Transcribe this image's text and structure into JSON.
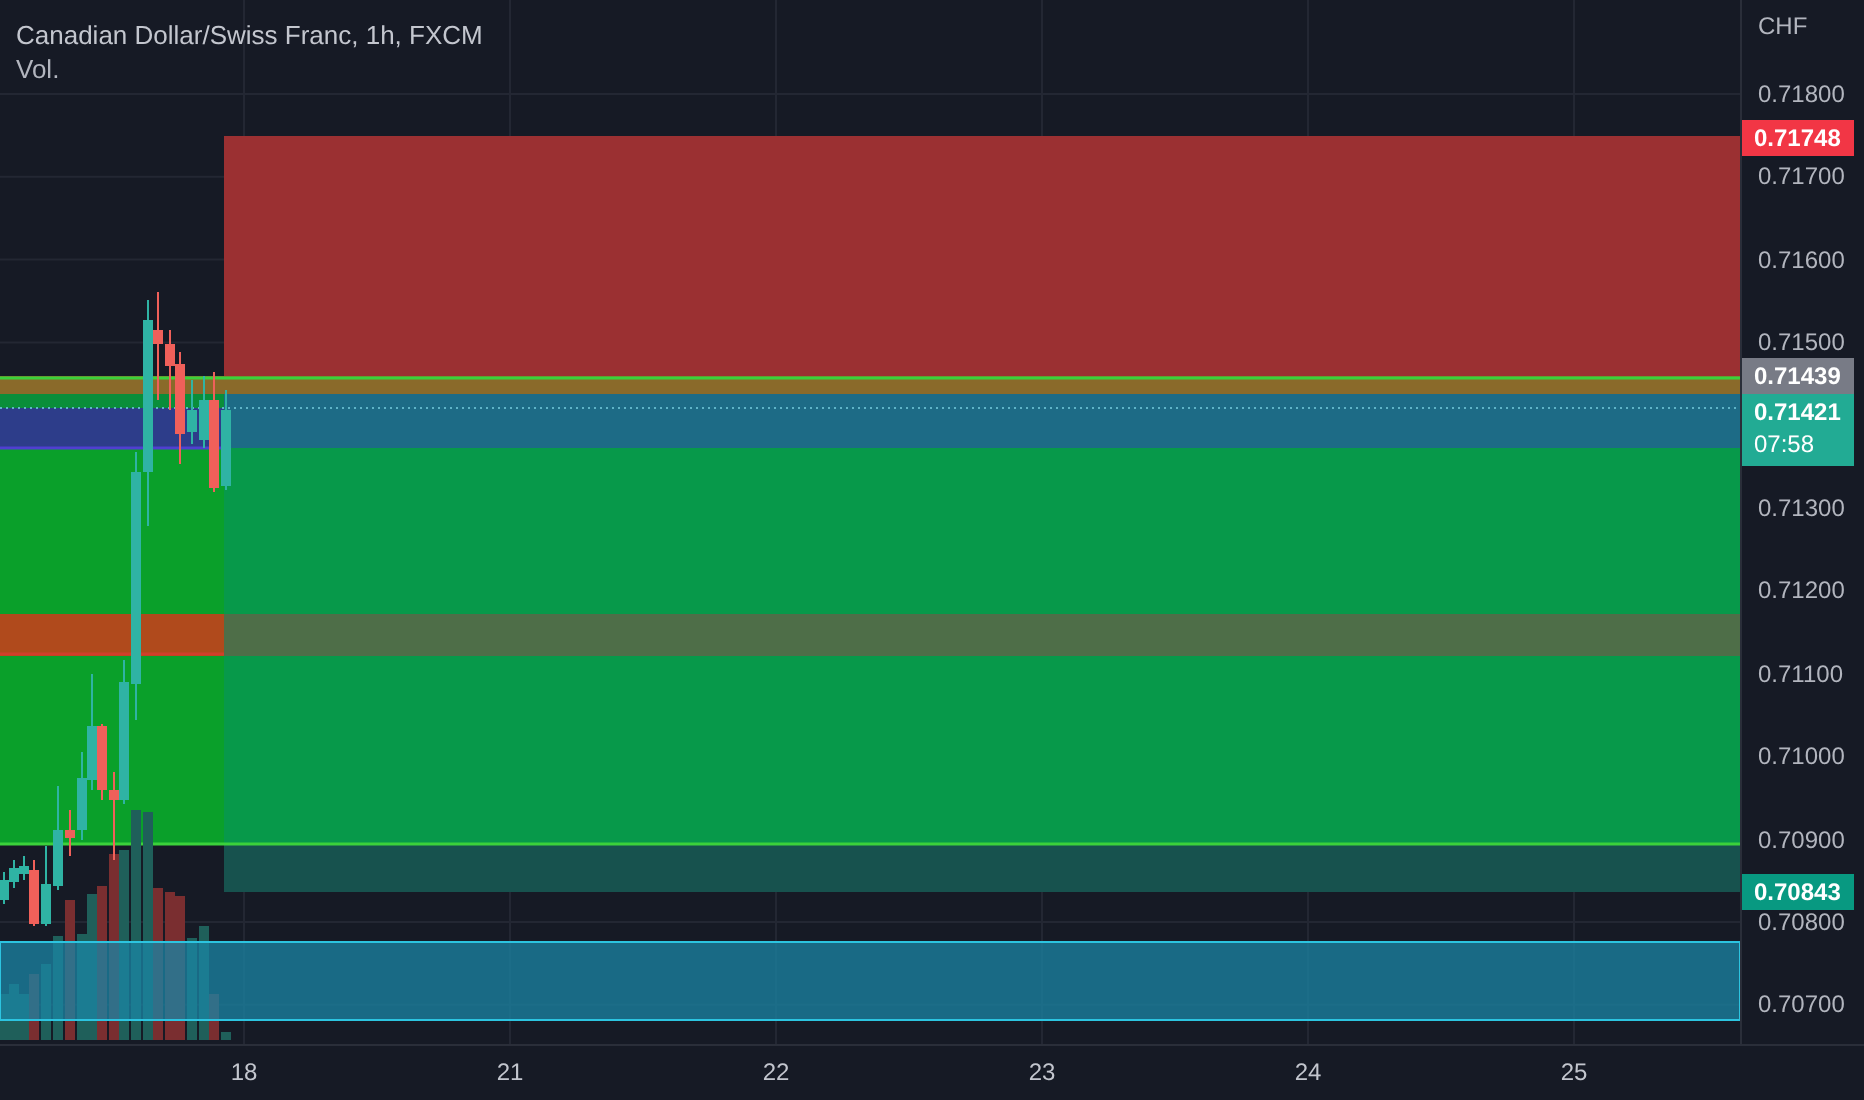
{
  "legend": {
    "title": "Canadian Dollar/Swiss Franc, 1h, FXCM",
    "volume_label": "Vol."
  },
  "price_axis": {
    "currency": "CHF",
    "ticks": [
      "0.71800",
      "0.71700",
      "0.71600",
      "0.71500",
      "0.71300",
      "0.71200",
      "0.71100",
      "0.71000",
      "0.70900",
      "0.70800",
      "0.70700"
    ],
    "badges": [
      {
        "kind": "single",
        "price": "0.71748",
        "color": "#f23645"
      },
      {
        "kind": "single",
        "price": "0.71439",
        "color": "#787b86"
      },
      {
        "kind": "countdown",
        "price": "0.71421",
        "time": "07:58",
        "color": "#22ab94"
      },
      {
        "kind": "single",
        "price": "0.70843",
        "color": "#089981"
      }
    ]
  },
  "time_axis": {
    "labels": [
      "18",
      "21",
      "22",
      "23",
      "24",
      "25"
    ]
  }
}
